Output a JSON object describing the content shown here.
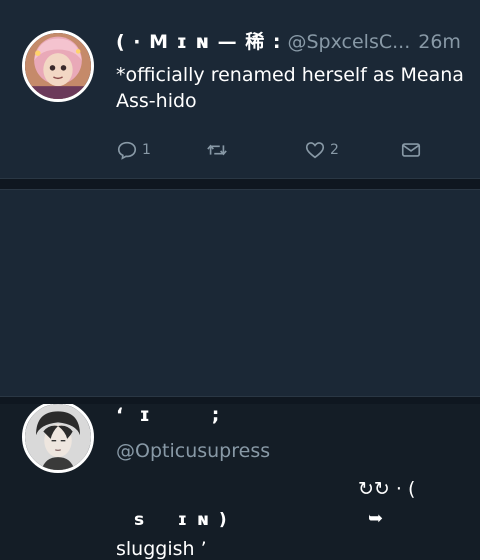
{
  "tweets": [
    {
      "display_name": "( · M ɪ ɴ — 稀 :",
      "handle": "@SpxcelsC...",
      "time": "26m",
      "text": "*officially renamed herself as Meana Ass-hido",
      "actions": {
        "reply_count": "1",
        "retweet_count": "",
        "like_count": "2"
      },
      "avatar_icon": "pink-haired-anime-avatar"
    },
    {
      "display_name": "‘  ɪ        ;",
      "handle": "@Opticusupress",
      "line_a": "↻↻ · (",
      "line_b": "s    ɪ ɴ )",
      "line_c": "➥",
      "text": "sluggish ’",
      "avatar_icon": "dark-haired-anime-avatar"
    }
  ],
  "colors": {
    "background": "#141d26",
    "card": "#1b2836",
    "secondary_text": "#8899a6",
    "primary_text": "#ffffff"
  }
}
